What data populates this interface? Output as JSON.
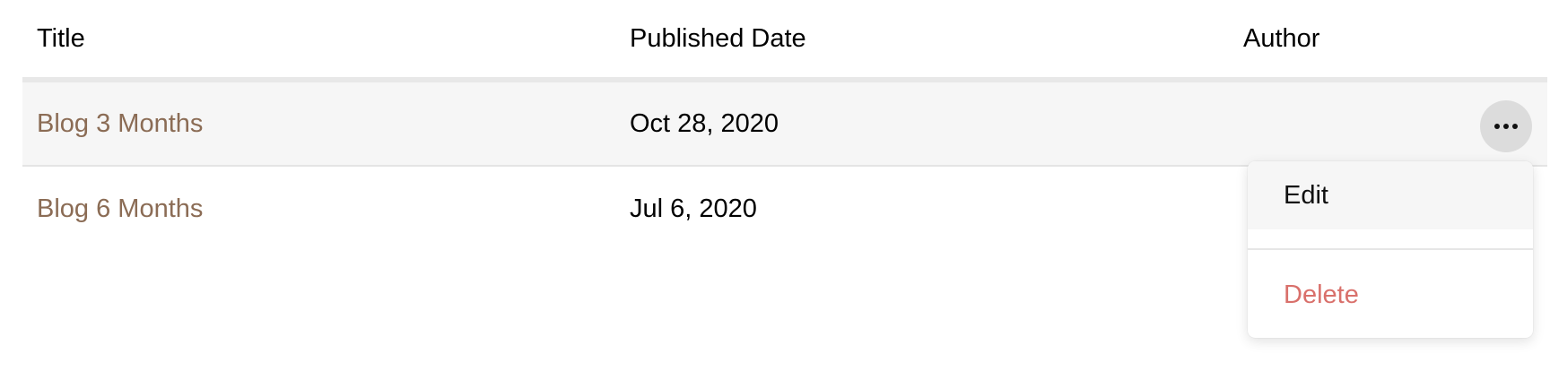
{
  "table": {
    "headers": {
      "title": "Title",
      "published_date": "Published Date",
      "author": "Author"
    },
    "rows": [
      {
        "title": "Blog 3 Months",
        "published_date": "Oct 28, 2020",
        "author": ""
      },
      {
        "title": "Blog 6 Months",
        "published_date": "Jul 6, 2020",
        "author": ""
      }
    ]
  },
  "row_menu": {
    "trigger_icon": "more-horizontal-icon",
    "items": {
      "edit": "Edit",
      "delete": "Delete"
    }
  },
  "colors": {
    "title_link": "#8b6c55",
    "delete": "#d9706b",
    "row_highlight": "#f6f6f6"
  }
}
